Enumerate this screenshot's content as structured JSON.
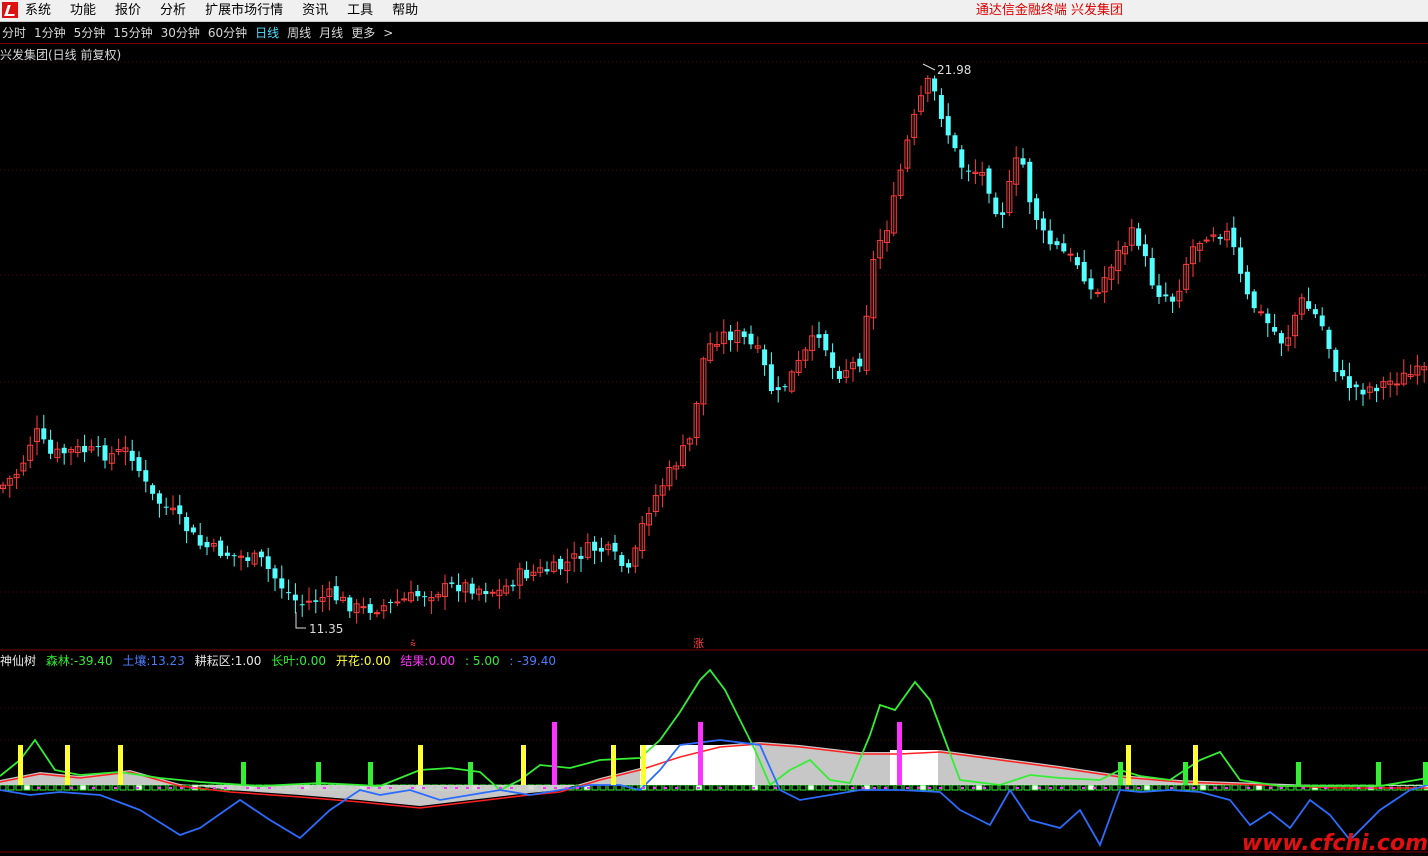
{
  "menubar": {
    "items": [
      "系统",
      "功能",
      "报价",
      "分析",
      "扩展市场行情",
      "资讯",
      "工具",
      "帮助"
    ],
    "brand": "通达信金融终端  兴发集团"
  },
  "periods": {
    "items": [
      "分时",
      "1分钟",
      "5分钟",
      "15分钟",
      "30分钟",
      "60分钟",
      "日线",
      "周线",
      "月线",
      "更多"
    ],
    "active": "日线"
  },
  "stock": {
    "title": "兴发集团(日线 前复权)",
    "high_label": "21.98",
    "low_label": "11.35",
    "marker_up": "涨"
  },
  "indicator": {
    "name": "神仙树",
    "items": [
      {
        "label": "森林:",
        "value": "-39.40",
        "color": "#33ee33"
      },
      {
        "label": "土壤:",
        "value": "13.23",
        "color": "#4a7cff"
      },
      {
        "label": "耕耘区:",
        "value": "1.00",
        "color": "#e8e8e8"
      },
      {
        "label": "长叶:",
        "value": "0.00",
        "color": "#33ee33"
      },
      {
        "label": "开花:",
        "value": "0.00",
        "color": "#ffff33"
      },
      {
        "label": "结果:",
        "value": "0.00",
        "color": "#ff33ff"
      }
    ],
    "extra1": ": 5.00",
    "extra2": ": -39.40"
  },
  "colors": {
    "up": "#ff3c3c",
    "down": "#54ffff",
    "grid": "#7a0000"
  },
  "chart_data": {
    "type": "candlestick",
    "price_high": 21.98,
    "price_low": 11.35,
    "watermark": "www.cfchi.com"
  }
}
